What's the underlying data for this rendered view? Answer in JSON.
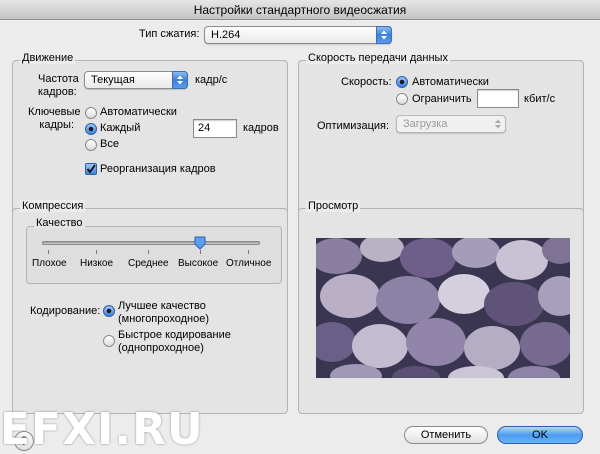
{
  "window": {
    "title": "Настройки стандартного видеосжатия"
  },
  "compression_type": {
    "label": "Тип сжатия:",
    "value": "H.264"
  },
  "motion": {
    "title": "Движение",
    "frame_rate_label": "Частота кадров:",
    "frame_rate_value": "Текущая",
    "frame_rate_unit": "кадр/с",
    "keyframes_label": "Ключевые кадры:",
    "options": [
      "Автоматически",
      "Каждый",
      "Все"
    ],
    "selected": "Каждый",
    "every_value": "24",
    "every_unit": "кадров",
    "reorder_label": "Реорганизация кадров",
    "reorder_checked": true
  },
  "data_rate": {
    "title": "Скорость передачи данных",
    "rate_label": "Скорость:",
    "auto_label": "Автоматически",
    "limit_label": "Ограничить",
    "limit_value": "",
    "unit": "кбит/с",
    "selected": "Автоматически",
    "optimize_label": "Оптимизация:",
    "optimize_value": "Загрузка"
  },
  "compression": {
    "title": "Компрессия",
    "quality_label": "Качество",
    "quality_levels": [
      "Плохое",
      "Низкое",
      "Среднее",
      "Высокое",
      "Отличное"
    ],
    "quality_selected": "Высокое",
    "quality_level_fraction": 0.75,
    "encoding_label": "Кодирование:",
    "best_label": "Лучшее качество",
    "best_sub": "(многопроходное)",
    "fast_label": "Быстрое кодирование",
    "fast_sub": "(однопроходное)",
    "encoding_selected": "best"
  },
  "preview": {
    "title": "Просмотр"
  },
  "buttons": {
    "cancel": "Отменить",
    "ok": "OK",
    "help": "?"
  },
  "watermark": "EFXI.RU",
  "colors": {
    "accent": "#3d84dd",
    "default_button": "#4a9cf0"
  }
}
